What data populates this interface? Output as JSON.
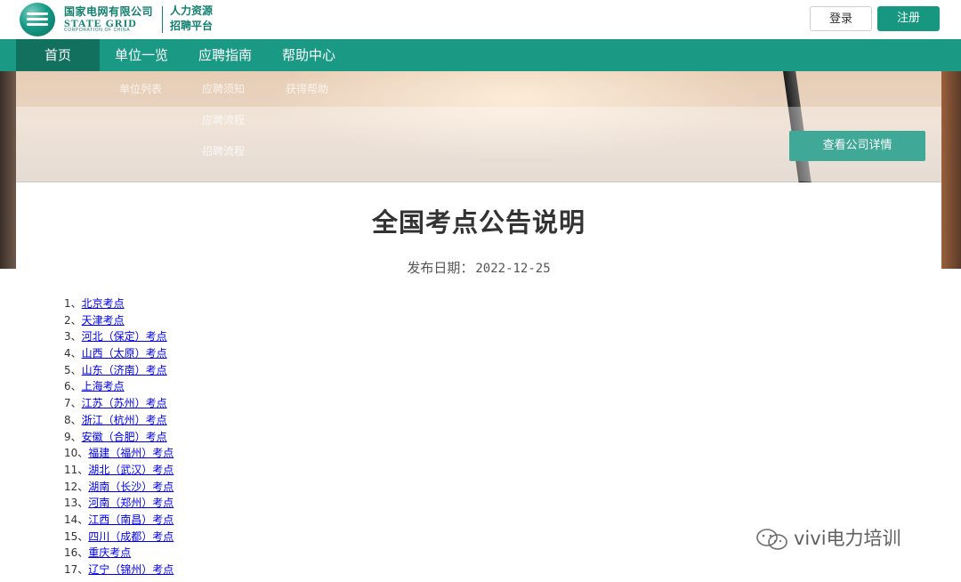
{
  "header": {
    "brand_cn": "国家电网有限公司",
    "brand_en": "STATE GRID",
    "brand_en_sub": "CORPORATION OF CHINA",
    "platform_line1": "人力资源",
    "platform_line2": "招聘平台",
    "login_label": "登录",
    "register_label": "注册"
  },
  "nav": {
    "items": [
      {
        "label": "首页"
      },
      {
        "label": "单位一览"
      },
      {
        "label": "应聘指南"
      },
      {
        "label": "帮助中心"
      }
    ],
    "submenu": {
      "unit_list": "单位列表",
      "apply_notice": "应聘须知",
      "apply_process": "应聘流程",
      "recruit_process": "招聘流程",
      "get_help": "获得帮助"
    }
  },
  "hero": {
    "detail_button": "查看公司详情"
  },
  "article": {
    "title": "全国考点公告说明",
    "date_label": "发布日期：",
    "date": "2022-12-25",
    "items": [
      {
        "num": "1、",
        "link": "北京考点"
      },
      {
        "num": "2、",
        "link": "天津考点"
      },
      {
        "num": "3、",
        "link": "河北（保定）考点"
      },
      {
        "num": "4、",
        "link": "山西（太原）考点"
      },
      {
        "num": "5、",
        "link": "山东（济南）考点"
      },
      {
        "num": "6、",
        "link": "上海考点"
      },
      {
        "num": "7、",
        "link": "江苏（苏州）考点"
      },
      {
        "num": "8、",
        "link": "浙江（杭州）考点"
      },
      {
        "num": "9、",
        "link": "安徽（合肥）考点"
      },
      {
        "num": "10、",
        "link": "福建（福州）考点"
      },
      {
        "num": "11、",
        "link": "湖北（武汉）考点"
      },
      {
        "num": "12、",
        "link": "湖南（长沙）考点"
      },
      {
        "num": "13、",
        "link": "河南（郑州）考点"
      },
      {
        "num": "14、",
        "link": "江西（南昌）考点"
      },
      {
        "num": "15、",
        "link": "四川（成都）考点"
      },
      {
        "num": "16、",
        "link": "重庆考点"
      },
      {
        "num": "17、",
        "link": "辽宁（锦州）考点"
      }
    ]
  },
  "watermark": {
    "text": "vivi电力培训",
    "icon": "wechat-icon"
  },
  "colors": {
    "brand_green": "#1a9a85",
    "nav_active": "#12705f",
    "link": "#0000ee"
  }
}
